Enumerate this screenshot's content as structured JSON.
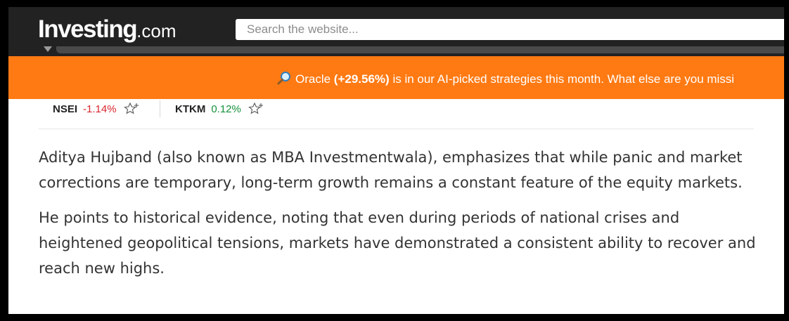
{
  "header": {
    "logo_main": "Investing",
    "logo_suffix": ".com",
    "search_placeholder": "Search the website..."
  },
  "banner": {
    "icon": "magnifier-icon",
    "prefix": "Oracle ",
    "highlight": "(+29.56%)",
    "suffix": " is in our AI-picked strategies this month. What else are you missi"
  },
  "tickers": [
    {
      "symbol": "NSEI",
      "change": "-1.14%",
      "direction": "down"
    },
    {
      "symbol": "KTKM",
      "change": "0.12%",
      "direction": "up"
    }
  ],
  "article": {
    "paragraphs": [
      "Aditya Hujband (also known as MBA Investmentwala), emphasizes that while panic and market corrections are temporary, long-term growth remains a constant feature of the equity markets.",
      "He points to historical evidence, noting that even during periods of national crises and heightened geopolitical tensions, markets have demonstrated a consistent ability to recover and reach new highs."
    ]
  },
  "colors": {
    "header_bg": "#222222",
    "banner_bg": "#ff7a13",
    "negative": "#d9262e",
    "positive": "#14913c"
  }
}
